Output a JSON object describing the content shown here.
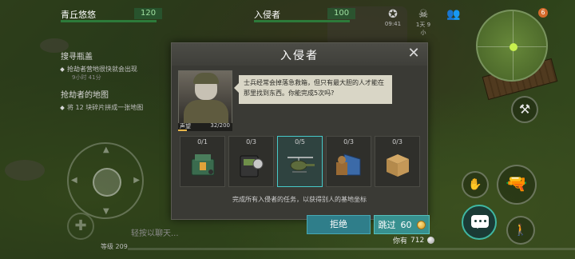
{
  "hud": {
    "player_name": "青丘悠悠",
    "player_hp": "120",
    "enemy_name": "入侵者",
    "enemy_hp": "100",
    "icon_timer_1": "09:41",
    "icon_timer_2": "1天 9小",
    "map_badge": "6"
  },
  "quests": [
    {
      "title": "搜寻瓶盖",
      "sub": "抢劫者营地很快就会出现",
      "timer": "9小时 41分"
    },
    {
      "title": "抢劫者的地图",
      "sub": "将 12 块碎片拼成一张地图",
      "timer": ""
    }
  ],
  "chat": {
    "placeholder": "轻按以聊天..."
  },
  "level": {
    "label": "等级 209"
  },
  "modal": {
    "title": "入侵者",
    "portrait_label": "声望",
    "portrait_count": "32/200",
    "portrait_progress": 0.16,
    "speech": "士兵经常会掉落急救箱，但只有最大胆的人才能在那里找到东西。你能完成5次吗?",
    "tasks": [
      {
        "count": "0/1",
        "item": "explosive-crate-icon"
      },
      {
        "count": "0/3",
        "item": "dog-tag-icon"
      },
      {
        "count": "0/5",
        "item": "helicopter-icon"
      },
      {
        "count": "0/3",
        "item": "dog-kennel-icon"
      },
      {
        "count": "0/3",
        "item": "cardboard-box-icon"
      }
    ],
    "note": "完成所有入侵者的任务，以获得别人的基地坐标",
    "refuse_label": "拒绝",
    "skip_label": "跳过",
    "skip_cost": "60",
    "balance_label": "你有",
    "balance_value": "712"
  },
  "colors": {
    "accent": "#37908f",
    "active_border": "#47c9c9",
    "hp_green": "#2d7a3a"
  }
}
